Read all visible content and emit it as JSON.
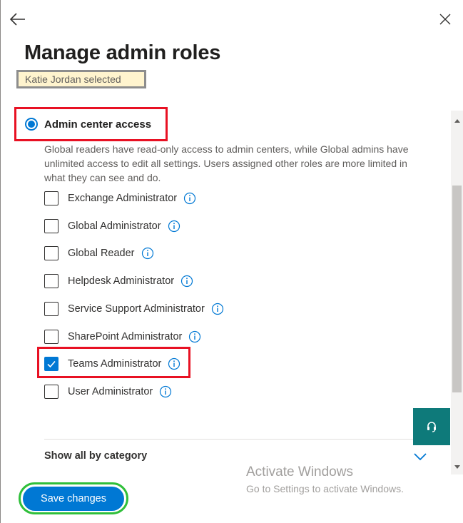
{
  "panel": {
    "title": "Manage admin roles",
    "selected_user": "Katie Jordan selected"
  },
  "access": {
    "radio_label": "Admin center access",
    "radio_selected": true,
    "description": "Global readers have read-only access to admin centers, while Global admins have unlimited access to edit all settings. Users assigned other roles are more limited in what they can see and do."
  },
  "roles": [
    {
      "label": "Exchange Administrator",
      "checked": false
    },
    {
      "label": "Global Administrator",
      "checked": false
    },
    {
      "label": "Global Reader",
      "checked": false
    },
    {
      "label": "Helpdesk Administrator",
      "checked": false
    },
    {
      "label": "Service Support Administrator",
      "checked": false
    },
    {
      "label": "SharePoint Administrator",
      "checked": false
    },
    {
      "label": "Teams Administrator",
      "checked": true
    },
    {
      "label": "User Administrator",
      "checked": false
    }
  ],
  "footer": {
    "show_all_label": "Show all by category",
    "save_label": "Save changes"
  },
  "watermark": {
    "title": "Activate Windows",
    "subtitle": "Go to Settings to activate Windows."
  },
  "icons": {
    "back": "arrow-left-icon",
    "close": "close-icon",
    "info": "info-icon",
    "chevron": "chevron-down-icon",
    "help": "headset-icon"
  },
  "colors": {
    "accent": "#0078d4",
    "annotation_red": "#e81123",
    "annotation_green": "#2fbf3a",
    "badge_bg": "#fff4ce",
    "help_bg": "#0e7a7a"
  }
}
